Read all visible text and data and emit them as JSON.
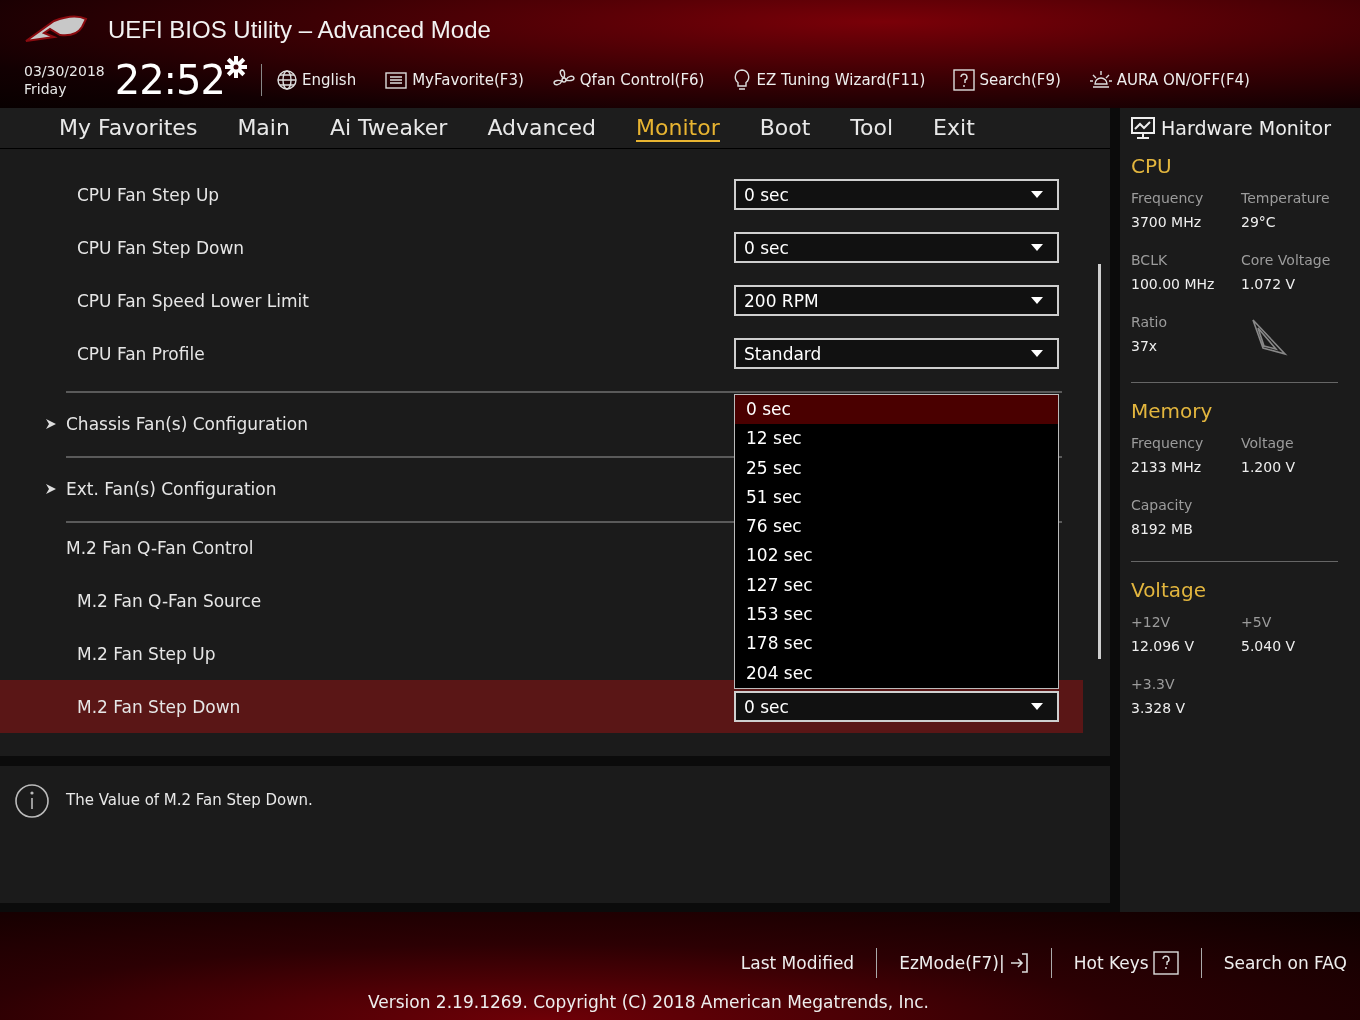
{
  "header": {
    "title": "UEFI BIOS Utility – Advanced Mode",
    "date": "03/30/2018",
    "day": "Friday",
    "time": "22:52",
    "tools": [
      {
        "kind": "globe",
        "label": "English"
      },
      {
        "kind": "favorite",
        "label": "MyFavorite(F3)"
      },
      {
        "kind": "fan",
        "label": "Qfan Control(F6)"
      },
      {
        "kind": "bulb",
        "label": "EZ Tuning Wizard(F11)"
      },
      {
        "kind": "search",
        "label": "Search(F9)"
      },
      {
        "kind": "aura",
        "label": "AURA ON/OFF(F4)"
      }
    ]
  },
  "tabs": [
    {
      "label": "My Favorites",
      "selected": false
    },
    {
      "label": "Main",
      "selected": false
    },
    {
      "label": "Ai Tweaker",
      "selected": false
    },
    {
      "label": "Advanced",
      "selected": false
    },
    {
      "label": "Monitor",
      "selected": true
    },
    {
      "label": "Boot",
      "selected": false
    },
    {
      "label": "Tool",
      "selected": false
    },
    {
      "label": "Exit",
      "selected": false
    }
  ],
  "settings": [
    {
      "kind": "select",
      "label": "CPU Fan Step Up",
      "value": "0 sec",
      "selected": false
    },
    {
      "kind": "select",
      "label": "CPU Fan Step Down",
      "value": "0 sec",
      "selected": false
    },
    {
      "kind": "select",
      "label": "CPU Fan Speed Lower Limit",
      "value": "200 RPM",
      "selected": false
    },
    {
      "kind": "select",
      "label": "CPU Fan Profile",
      "value": "Standard",
      "selected": false
    },
    {
      "kind": "submenu",
      "label": "Chassis Fan(s) Configuration",
      "selected": false
    },
    {
      "kind": "submenu",
      "label": "Ext. Fan(s) Configuration",
      "selected": false
    },
    {
      "kind": "heading",
      "label": "M.2 Fan Q-Fan Control",
      "selected": false
    },
    {
      "kind": "item",
      "label": "M.2 Fan Q-Fan Source",
      "selected": false
    },
    {
      "kind": "item",
      "label": "M.2 Fan Step Up",
      "selected": false
    },
    {
      "kind": "select",
      "label": "M.2 Fan Step Down",
      "value": "0 sec",
      "selected": true
    }
  ],
  "popup": {
    "options": [
      {
        "label": "0 sec",
        "selected": true
      },
      {
        "label": "12 sec",
        "selected": false
      },
      {
        "label": "25 sec",
        "selected": false
      },
      {
        "label": "51 sec",
        "selected": false
      },
      {
        "label": "76 sec",
        "selected": false
      },
      {
        "label": "102 sec",
        "selected": false
      },
      {
        "label": "127 sec",
        "selected": false
      },
      {
        "label": "153 sec",
        "selected": false
      },
      {
        "label": "178 sec",
        "selected": false
      },
      {
        "label": "204 sec",
        "selected": false
      }
    ]
  },
  "help": {
    "text": "The Value of M.2 Fan Step Down."
  },
  "hardware_monitor": {
    "title": "Hardware Monitor",
    "sections": [
      {
        "title": "CPU",
        "entries": [
          {
            "label": "Frequency",
            "value": "3700 MHz"
          },
          {
            "label": "Temperature",
            "value": "29°C"
          },
          {
            "label": "BCLK",
            "value": "100.00 MHz"
          },
          {
            "label": "Core Voltage",
            "value": "1.072 V"
          },
          {
            "label": "Ratio",
            "value": "37x"
          }
        ],
        "icon": true
      },
      {
        "title": "Memory",
        "entries": [
          {
            "label": "Frequency",
            "value": "2133 MHz"
          },
          {
            "label": "Voltage",
            "value": "1.200 V"
          },
          {
            "label": "Capacity",
            "value": "8192 MB"
          }
        ]
      },
      {
        "title": "Voltage",
        "entries": [
          {
            "label": "+12V",
            "value": "12.096 V"
          },
          {
            "label": "+5V",
            "value": "5.040 V"
          },
          {
            "label": "+3.3V",
            "value": "3.328 V"
          }
        ]
      }
    ]
  },
  "footer": {
    "links": [
      {
        "kind": "text",
        "label": "Last Modified"
      },
      {
        "kind": "exit",
        "label": "EzMode(F7)|"
      },
      {
        "kind": "help",
        "label": "Hot Keys"
      },
      {
        "kind": "text",
        "label": "Search on FAQ"
      }
    ],
    "version": "Version 2.19.1269. Copyright (C) 2018 American Megatrends, Inc."
  }
}
